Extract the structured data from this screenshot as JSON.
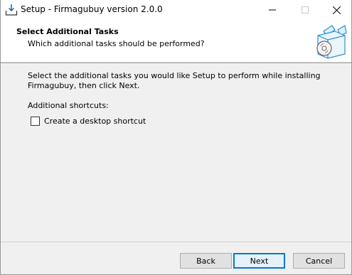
{
  "window": {
    "title": "Setup - Firmagubuy version 2.0.0"
  },
  "header": {
    "title": "Select Additional Tasks",
    "subtitle": "Which additional tasks should be performed?"
  },
  "main": {
    "description": "Select the additional tasks you would like Setup to perform while installing Firmagubuy, then click Next.",
    "shortcuts_label": "Additional shortcuts:",
    "desktop_shortcut": {
      "label": "Create a desktop shortcut",
      "checked": false
    }
  },
  "footer": {
    "back_label": "Back",
    "next_label": "Next",
    "cancel_label": "Cancel"
  }
}
